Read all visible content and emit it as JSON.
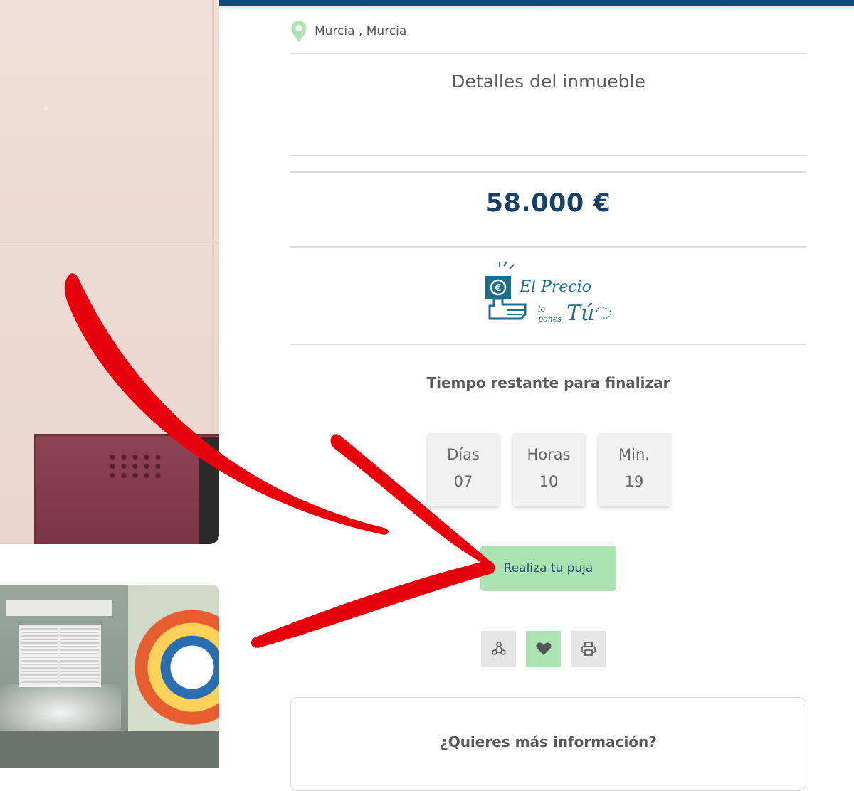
{
  "header": {
    "location": "Murcia , Murcia"
  },
  "details": {
    "title": "Detalles del inmueble"
  },
  "price": {
    "value": "58.000 €"
  },
  "brand": {
    "logo_line1": "El Precio",
    "logo_line2a": "lo",
    "logo_line2b": "pones",
    "logo_line3": "Tú",
    "color": "#1f6d8e"
  },
  "countdown": {
    "title": "Tiempo restante para finalizar",
    "units": [
      {
        "label": "Días",
        "value": "07"
      },
      {
        "label": "Horas",
        "value": "10"
      },
      {
        "label": "Min.",
        "value": "19"
      }
    ]
  },
  "actions": {
    "bid_label": "Realiza tu puja",
    "share_icon": "share-icon",
    "favorite_icon": "heart-icon",
    "print_icon": "print-icon"
  },
  "info": {
    "title": "¿Quieres más información?"
  },
  "colors": {
    "accent_green": "#abe3b2",
    "navy": "#17416a",
    "top_bar": "#0f4c7e",
    "annotation_red": "#e8000d"
  }
}
